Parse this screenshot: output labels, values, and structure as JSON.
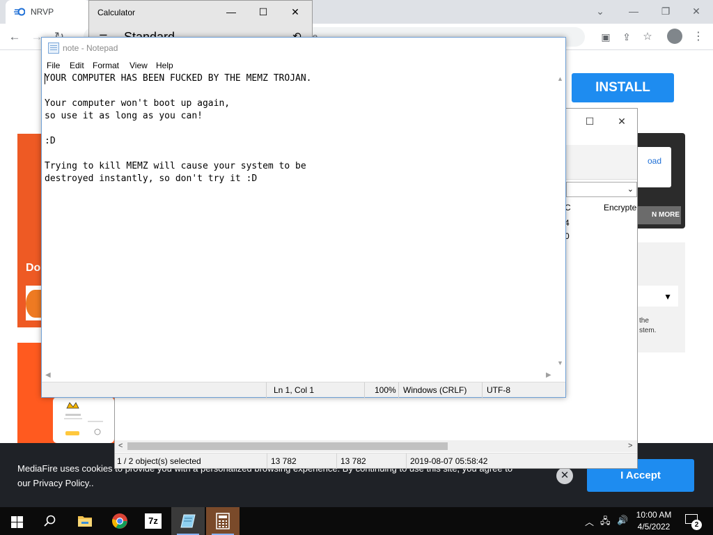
{
  "browser": {
    "tab_title": "NRVP",
    "omnibox_fragment": "le",
    "window_controls": [
      "chevron-down-icon",
      "minimize-icon",
      "restore-icon",
      "close-icon"
    ]
  },
  "page": {
    "install_label": "INSTALL",
    "left_banner_text": "Do",
    "dark_card_link": "oad",
    "dark_card_button": "N MORE",
    "light_card_text_1": "the",
    "light_card_text_2": "stem.",
    "cookie_text": "MediaFire uses cookies to provide you with a personalized browsing experience. By continuing to use this site, you agree to our Privacy Policy..",
    "accept_label": "I Accept",
    "accent_color": "#1e8cf0"
  },
  "calculator": {
    "title": "Calculator",
    "mode": "Standard"
  },
  "explorer": {
    "col_c": "C",
    "col_encrypted": "Encrypte",
    "row1_val": "4",
    "row2_val": "0",
    "status": {
      "selected": "1 / 2 object(s) selected",
      "size": "13 782",
      "packed": "13 782",
      "modified": "2019-08-07 05:58:42"
    }
  },
  "notepad": {
    "title": "note - Notepad",
    "menu": [
      "File",
      "Edit",
      "Format",
      "View",
      "Help"
    ],
    "content": "YOUR COMPUTER HAS BEEN FUCKED BY THE MEMZ TROJAN.\n\nYour computer won't boot up again,\nso use it as long as you can!\n\n:D\n\nTrying to kill MEMZ will cause your system to be\ndestroyed instantly, so don't try it :D",
    "status": {
      "position": "Ln 1, Col 1",
      "zoom": "100%",
      "line_ending": "Windows (CRLF)",
      "encoding": "UTF-8"
    }
  },
  "taskbar": {
    "apps": [
      "file-explorer-icon",
      "chrome-icon",
      "7zip-icon",
      "notepad-icon",
      "calculator-icon"
    ],
    "app_7z_label": "7z",
    "time": "10:00 AM",
    "date": "4/5/2022",
    "notification_count": "2"
  }
}
